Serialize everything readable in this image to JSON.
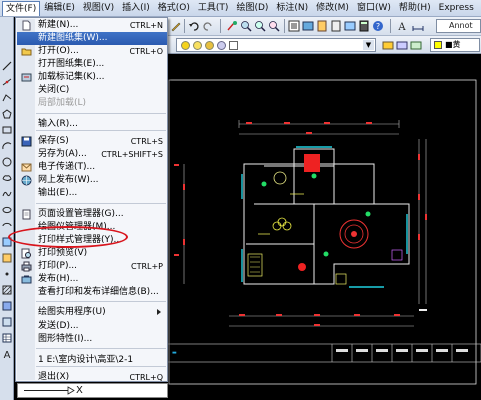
{
  "menubar": {
    "items": [
      "文件(F)",
      "编辑(E)",
      "视图(V)",
      "插入(I)",
      "格式(O)",
      "工具(T)",
      "绘图(D)",
      "标注(N)",
      "修改(M)",
      "窗口(W)",
      "帮助(H)",
      "Express"
    ],
    "active_index": 0
  },
  "toolbar": {
    "annotation_label": "Annot",
    "color_label": "■黄"
  },
  "file_menu": {
    "items": [
      {
        "label": "新建(N)...",
        "shortcut": "CTRL+N",
        "icon": "new-file-icon",
        "state": "normal"
      },
      {
        "label": "新建图纸集(W)...",
        "shortcut": "",
        "icon": "",
        "state": "highlighted"
      },
      {
        "label": "打开(O)...",
        "shortcut": "CTRL+O",
        "icon": "open-folder-icon",
        "state": "normal"
      },
      {
        "label": "打开图纸集(E)...",
        "shortcut": "",
        "icon": "",
        "state": "normal"
      },
      {
        "label": "加载标记集(K)...",
        "shortcut": "",
        "icon": "markup-icon",
        "state": "normal"
      },
      {
        "label": "关闭(C)",
        "shortcut": "",
        "icon": "",
        "state": "normal"
      },
      {
        "label": "局部加载(L)",
        "shortcut": "",
        "icon": "",
        "state": "disabled"
      },
      {
        "label": "输入(R)...",
        "shortcut": "",
        "icon": "",
        "state": "normal"
      },
      {
        "label": "保存(S)",
        "shortcut": "CTRL+S",
        "icon": "save-icon",
        "state": "normal"
      },
      {
        "label": "另存为(A)...",
        "shortcut": "CTRL+SHIFT+S",
        "icon": "",
        "state": "normal"
      },
      {
        "label": "电子传递(T)...",
        "shortcut": "",
        "icon": "etransmit-icon",
        "state": "normal"
      },
      {
        "label": "网上发布(W)...",
        "shortcut": "",
        "icon": "publish-web-icon",
        "state": "normal"
      },
      {
        "label": "输出(E)...",
        "shortcut": "",
        "icon": "",
        "state": "normal"
      },
      {
        "label": "页面设置管理器(G)...",
        "shortcut": "",
        "icon": "page-setup-icon",
        "state": "normal"
      },
      {
        "label": "绘图仪管理器(M)...",
        "shortcut": "",
        "icon": "",
        "state": "normal"
      },
      {
        "label": "打印样式管理器(Y)...",
        "shortcut": "",
        "icon": "",
        "state": "normal"
      },
      {
        "label": "打印预览(V)",
        "shortcut": "",
        "icon": "print-preview-icon",
        "state": "normal"
      },
      {
        "label": "打印(P)...",
        "shortcut": "CTRL+P",
        "icon": "printer-icon",
        "state": "normal"
      },
      {
        "label": "发布(H)...",
        "shortcut": "",
        "icon": "publish-icon",
        "state": "normal"
      },
      {
        "label": "查看打印和发布详细信息(B)...",
        "shortcut": "",
        "icon": "",
        "state": "normal"
      },
      {
        "label": "绘图实用程序(U)",
        "shortcut": "",
        "icon": "",
        "state": "submenu"
      },
      {
        "label": "发送(D)...",
        "shortcut": "",
        "icon": "",
        "state": "normal"
      },
      {
        "label": "图形特性(I)...",
        "shortcut": "",
        "icon": "",
        "state": "normal"
      },
      {
        "label": "1 E:\\室内设计\\高亚\\2-1",
        "shortcut": "",
        "icon": "",
        "state": "normal"
      },
      {
        "label": "退出(X)",
        "shortcut": "CTRL+Q",
        "icon": "",
        "state": "normal"
      }
    ]
  },
  "command_line": {
    "text": "X"
  },
  "colors": {
    "accent": "#2b5ab0",
    "annotation_ellipse": "#d8141c",
    "drawing_bg": "#000000"
  }
}
